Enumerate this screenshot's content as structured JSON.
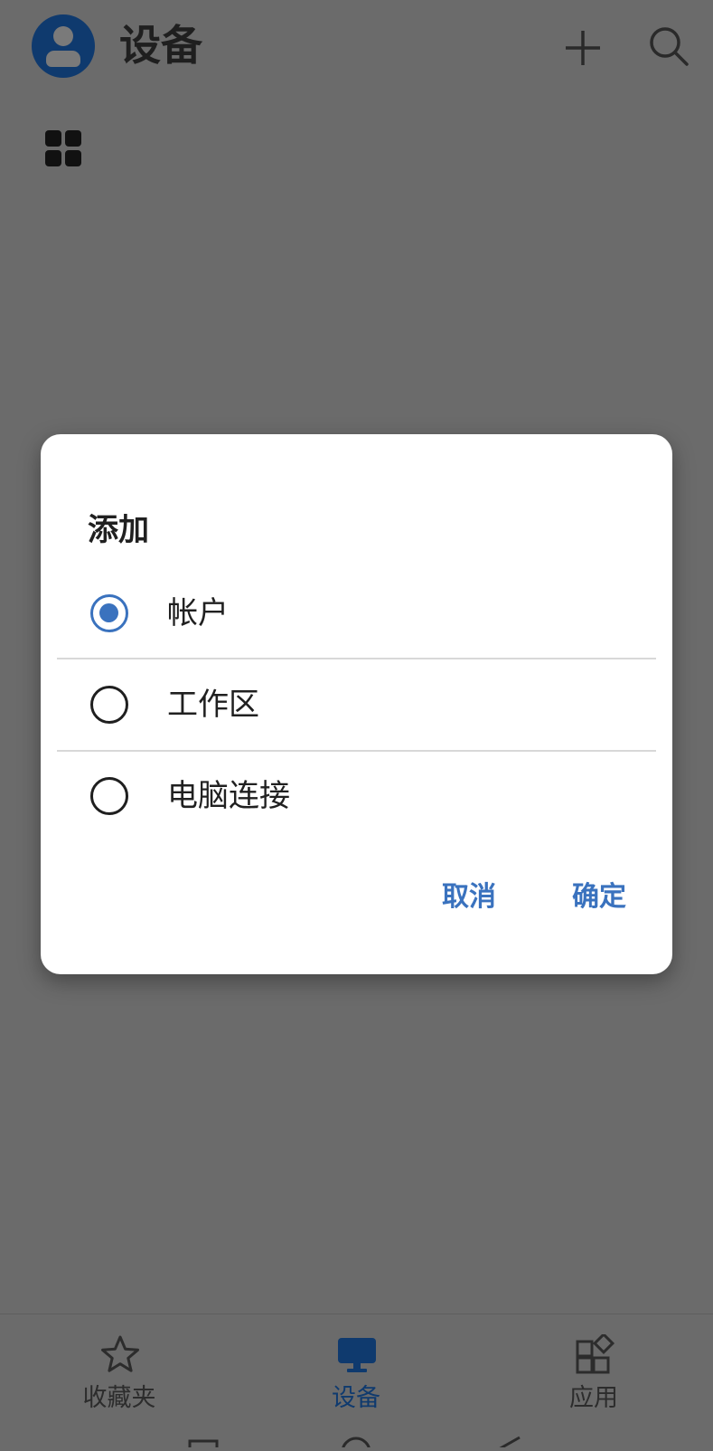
{
  "header": {
    "title": "设备"
  },
  "dialog": {
    "title": "添加",
    "options": [
      {
        "label": "帐户",
        "checked": true
      },
      {
        "label": "工作区",
        "checked": false
      },
      {
        "label": "电脑连接",
        "checked": false
      }
    ],
    "cancel_label": "取消",
    "ok_label": "确定"
  },
  "bottom_nav": {
    "items": [
      {
        "label": "收藏夹",
        "icon": "star-icon",
        "active": false
      },
      {
        "label": "设备",
        "icon": "monitor-icon",
        "active": true
      },
      {
        "label": "应用",
        "icon": "apps-icon",
        "active": false
      }
    ]
  },
  "colors": {
    "scrim": "#6b6b6b",
    "accent": "#3a72be",
    "brand_dark": "#0f3a6e"
  }
}
